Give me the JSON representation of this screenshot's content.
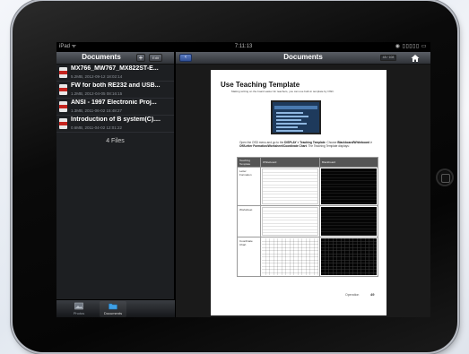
{
  "statusbar": {
    "carrier": "iPad ᯤ",
    "time": "7:11:13",
    "battery": "◉ ▯▯▯▯▯ ▭"
  },
  "left": {
    "title": "Documents",
    "add_label": "+",
    "edit_label": "Edit",
    "files": [
      {
        "name": "MX766_MW767_MX822ST-E...",
        "meta": "5.2MB, 2012-09-12 18:02:14"
      },
      {
        "name": "FW for both RE232 and USB...",
        "meta": "1.2MB, 2012-04-05 08:16:15"
      },
      {
        "name": "ANSI - 1997 Electronic Proj...",
        "meta": "1.3MB, 2011-06-02 15:48:27"
      },
      {
        "name": "Introduction of B system(C)....",
        "meta": "0.6MB, 2011-04-02 12:01:22"
      }
    ],
    "files_count": "4 Files",
    "tabs": [
      {
        "label": "Photos",
        "icon": "photos-icon"
      },
      {
        "label": "Documents",
        "icon": "documents-icon"
      }
    ]
  },
  "right": {
    "back_label": "‹",
    "title": "Documents",
    "page_indicator": "48 / 108",
    "home_icon": "home-icon"
  },
  "document": {
    "title": "Use Teaching Template",
    "intro": "Making writing on the board easier for teachers, you can use built-in template by OSD.",
    "instruction_parts": [
      "Open the OSD menu and go to the ",
      "DISPLAY > Teaching Template",
      ". Choose ",
      "Blackboard/Whiteboard > Off/Letter Formation/Worksheet/Coordinate Chart",
      ". The Teaching Template displays:"
    ],
    "table": {
      "headers": [
        "Teaching Template",
        "Whiteboard",
        "Blackboard"
      ],
      "rows": [
        "Letter Formation",
        "Worksheet",
        "Coordinate Chart"
      ]
    },
    "footer": "Operation",
    "page_number": "49"
  },
  "colors": {
    "pdf_red": "#c4241e",
    "back_button_blue": "#3f62ad",
    "header_gray": "#45484e"
  }
}
